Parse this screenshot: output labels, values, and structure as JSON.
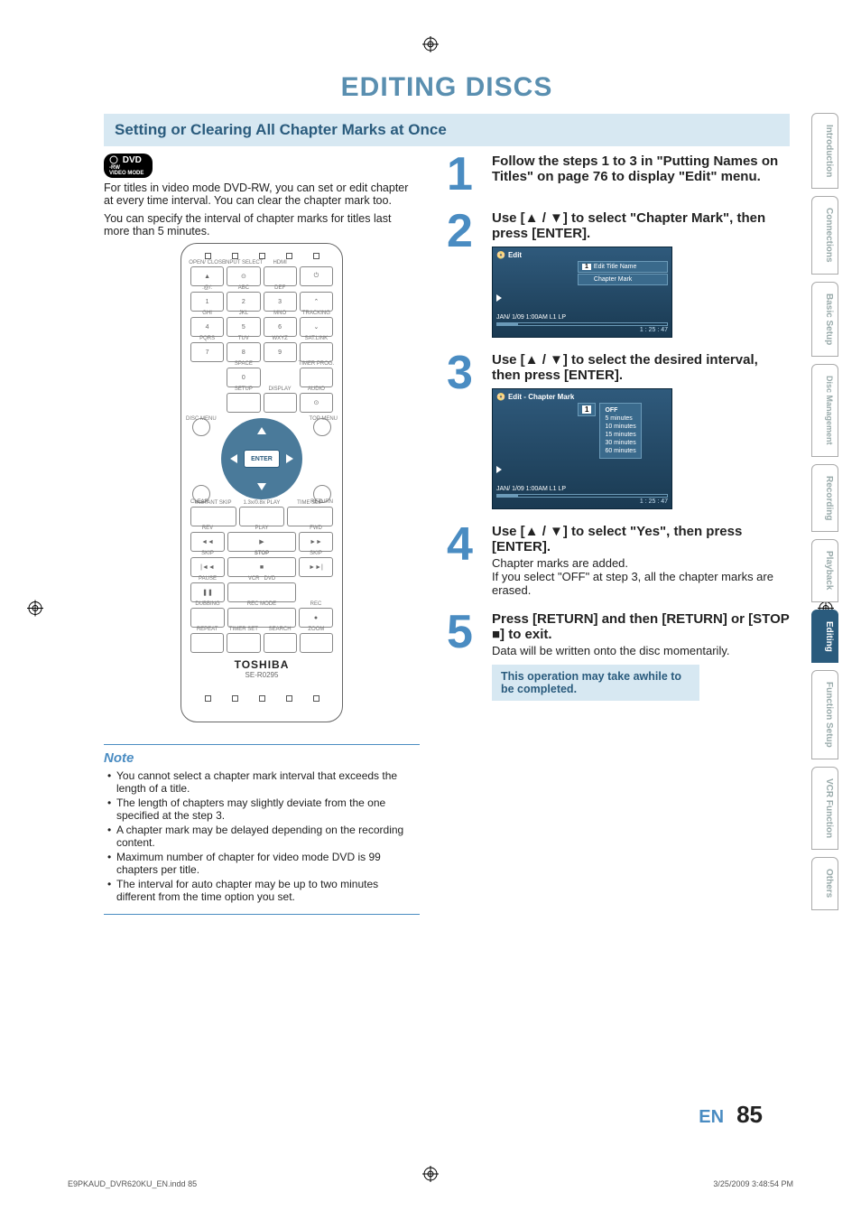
{
  "page_title": "EDITING DISCS",
  "section_title": "Setting or Clearing All Chapter Marks at Once",
  "badge": {
    "main": "DVD",
    "sub1": "-RW",
    "sub2": "VIDEO MODE"
  },
  "intro1": "For titles in video mode DVD-RW, you can set or edit chapter at every time interval. You can clear the chapter mark too.",
  "intro2": "You can specify the interval of chapter marks for titles last more than 5 minutes.",
  "remote": {
    "row1": [
      "OPEN/\nCLOSE",
      "INPUT\nSELECT",
      "HDMI",
      ""
    ],
    "row2_lbl": [
      ".@/:",
      "ABC",
      "DEF",
      ""
    ],
    "row2": [
      "1",
      "2",
      "3",
      ""
    ],
    "row3_lbl": [
      "GHI",
      "JKL",
      "MNO",
      "TRACKING"
    ],
    "row3": [
      "4",
      "5",
      "6",
      ""
    ],
    "row4_lbl": [
      "PQRS",
      "TUV",
      "WXYZ",
      "SAT.LINK"
    ],
    "row4": [
      "7",
      "8",
      "9",
      ""
    ],
    "row5_lbl": [
      "",
      "SPACE",
      "",
      "TIMER\nPROG."
    ],
    "row5": [
      "",
      "0",
      "",
      ""
    ],
    "row6_lbl": [
      "",
      "SETUP",
      "DISPLAY",
      "AUDIO"
    ],
    "row6": [
      "",
      "",
      "",
      ""
    ],
    "discmenu": "DISC MENU",
    "topmenu": "TOP MENU",
    "clear": "CLEAR",
    "return": "RETURN",
    "enter": "ENTER",
    "tr_row_lbl": [
      "INSTANT\nSKIP",
      "1.3x/0.8x\nPLAY",
      "TIME SLIP"
    ],
    "rev": "REV",
    "play": "PLAY",
    "fwd": "FWD",
    "skipL": "SKIP",
    "stop": "STOP",
    "skipR": "SKIP",
    "pause": "PAUSE",
    "vcr": "VCR",
    "dvd": "DVD",
    "dubbing": "DUBBING",
    "recmode": "REC MODE",
    "rec": "REC",
    "repeat": "REPEAT",
    "timerset": "TIMER SET",
    "search": "SEARCH",
    "zoom": "ZOOM",
    "brand": "TOSHIBA",
    "model": "SE-R0295"
  },
  "steps": {
    "s1": "Follow the steps 1 to 3 in \"Putting Names on Titles\" on page 76 to display \"Edit\" menu.",
    "s2": "Use [▲ / ▼] to select \"Chapter Mark\", then press [ENTER].",
    "s3": "Use [▲ / ▼] to select the desired interval, then press [ENTER].",
    "s4_head": "Use [▲ / ▼] to select \"Yes\", then press [ENTER].",
    "s4_body1": "Chapter marks are added.",
    "s4_body2": "If you select \"OFF\" at step 3, all the chapter marks are erased.",
    "s5_head": "Press [RETURN] and then [RETURN] or [STOP ■] to exit.",
    "s5_body": "Data will be written onto the disc momentarily."
  },
  "osd1": {
    "title": "Edit",
    "item1": "Edit Title Name",
    "item2": "Chapter Mark",
    "status": "JAN/ 1/09 1:00AM L1    LP",
    "time": "1 : 25 : 47"
  },
  "osd2": {
    "title": "Edit - Chapter Mark",
    "opts": [
      "OFF",
      "5 minutes",
      "10 minutes",
      "15 minutes",
      "30 minutes",
      "60 minutes"
    ],
    "status": "JAN/ 1/09 1:00AM L1    LP",
    "time": "1 : 25 : 47"
  },
  "tip": "This operation may take awhile to be completed.",
  "note_title": "Note",
  "notes": [
    "You cannot select a chapter mark interval that exceeds the length of a title.",
    "The length of chapters may slightly deviate from the one specified at the step 3.",
    "A chapter mark may be delayed depending on the recording content.",
    "Maximum number of chapter for video mode DVD is 99 chapters per title.",
    "The interval for auto chapter may be up to two minutes different from the time option you set."
  ],
  "footer": {
    "lang": "EN",
    "page": "85"
  },
  "sidebar": [
    "Introduction",
    "Connections",
    "Basic Setup",
    "Disc\nManagement",
    "Recording",
    "Playback",
    "Editing",
    "Function Setup",
    "VCR Function",
    "Others"
  ],
  "sidebar_active": 6,
  "print": {
    "file": "E9PKAUD_DVR620KU_EN.indd   85",
    "date": "3/25/2009   3:48:54 PM"
  }
}
